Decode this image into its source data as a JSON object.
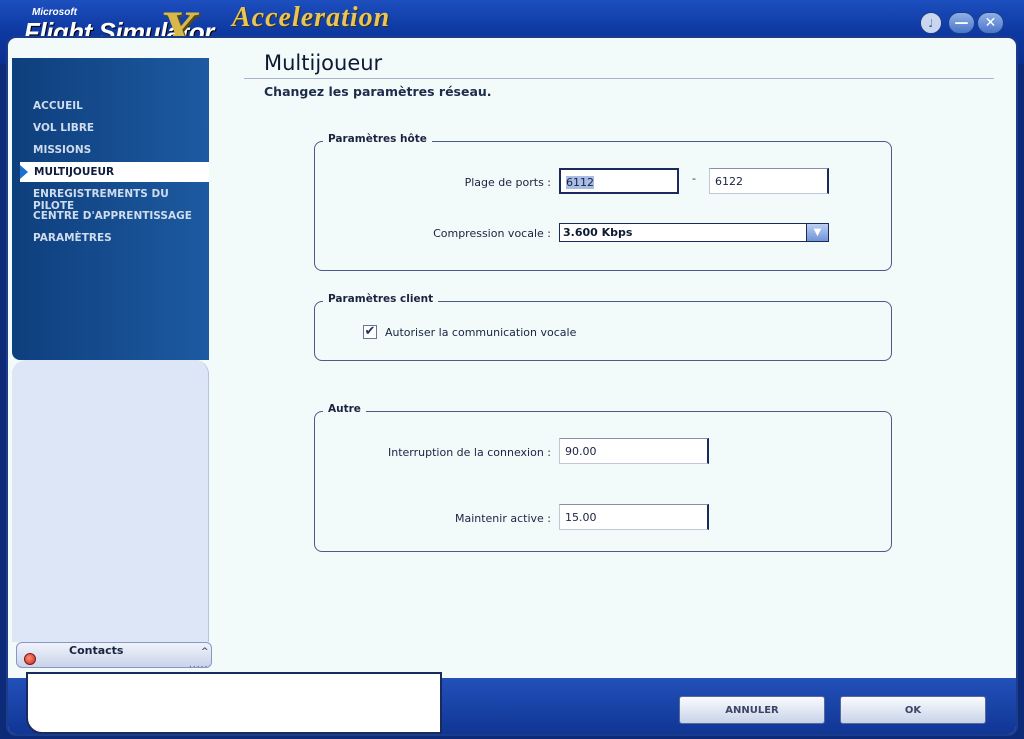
{
  "app": {
    "logo_ms": "Microsoft",
    "logo_title": "Flight Simulator",
    "logo_x": "X",
    "logo_sub": "Acceleration"
  },
  "window_controls": {
    "sound_icon": "speaker-icon",
    "minimize": "—",
    "close": "✕"
  },
  "nav": {
    "items": [
      {
        "label": "ACCUEIL"
      },
      {
        "label": "VOL LIBRE"
      },
      {
        "label": "MISSIONS"
      },
      {
        "label": "MULTIJOUEUR",
        "active": true
      },
      {
        "label": "ENREGISTREMENTS DU PILOTE"
      },
      {
        "label": "CENTRE D'APPRENTISSAGE"
      },
      {
        "label": "PARAMÈTRES"
      }
    ]
  },
  "contacts": {
    "label": "Contacts",
    "chevron": "^",
    "grip": "....."
  },
  "main": {
    "title": "Multijoueur",
    "subtitle": "Changez les paramètres réseau.",
    "host": {
      "legend": "Paramètres hôte",
      "port_label": "Plage de ports :",
      "port_from": "6112",
      "port_dash": "-",
      "port_to": "6122",
      "voice_label": "Compression vocale :",
      "voice_value": "3.600 Kbps"
    },
    "client": {
      "legend": "Paramètres client",
      "voice_checkbox_label": "Autoriser la communication vocale",
      "voice_checked": true
    },
    "other": {
      "legend": "Autre",
      "timeout_label": "Interruption de la connexion :",
      "timeout_value": "90.00",
      "keepalive_label": "Maintenir active :",
      "keepalive_value": "15.00"
    }
  },
  "footer": {
    "cancel_label": "ANNULER",
    "ok_label": "OK"
  }
}
